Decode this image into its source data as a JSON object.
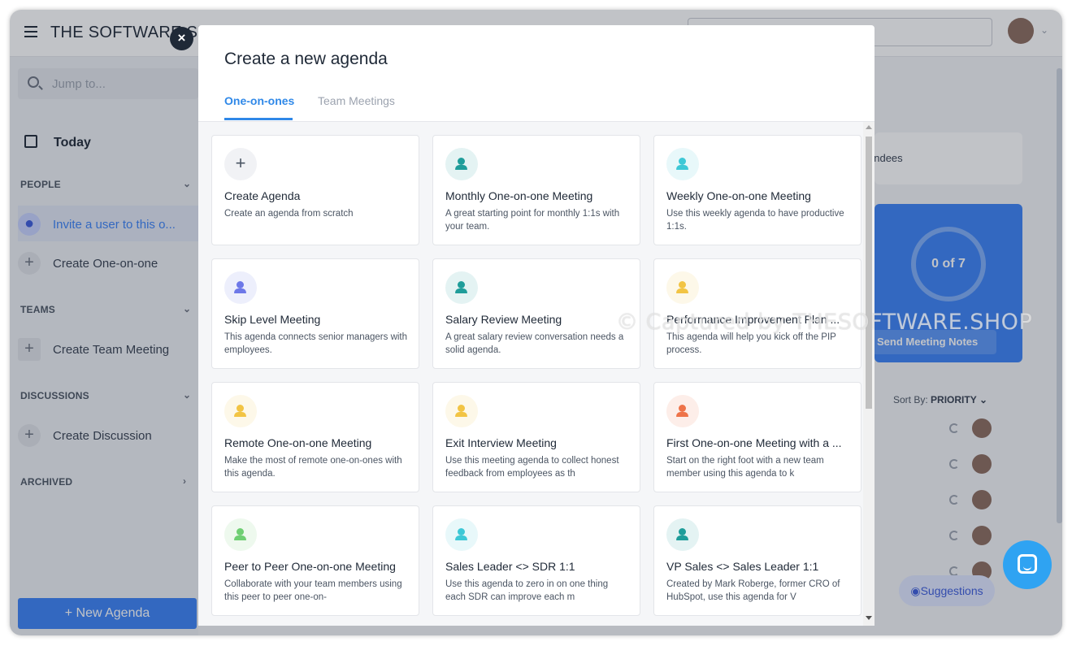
{
  "app": {
    "brand": "THE SOFTWARE SHOP",
    "search_placeholder": "Jump to...",
    "today_label": "Today",
    "sections": {
      "people": "PEOPLE",
      "teams": "TEAMS",
      "discussions": "DISCUSSIONS",
      "archived": "ARCHIVED"
    },
    "items": {
      "invite_user": "Invite a user to this o...",
      "create_one_on_one": "Create One-on-one",
      "create_team_meeting": "Create Team Meeting",
      "create_discussion": "Create Discussion"
    },
    "new_agenda_label": "New Agenda"
  },
  "background_panel": {
    "attendees_text": "endees",
    "progress_text": "0 of 7",
    "send_notes_label": "& Send Meeting Notes",
    "sort_by_label": "Sort By:",
    "sort_by_value": "PRIORITY",
    "suggestions_label": "Suggestions"
  },
  "modal": {
    "close_label": "×",
    "title": "Create a new agenda",
    "tabs": [
      {
        "label": "One-on-ones",
        "active": true
      },
      {
        "label": "Team Meetings",
        "active": false
      }
    ],
    "cards": [
      {
        "title": "Create Agenda",
        "desc": "Create an agenda from scratch",
        "icon": "plus-icon",
        "color": "#f1f2f5"
      },
      {
        "title": "Monthly One-on-one Meeting",
        "desc": "A great starting point for monthly 1:1s with your team.",
        "icon": "person-icon",
        "color": "#1f9d9a"
      },
      {
        "title": "Weekly One-on-one Meeting",
        "desc": "Use this weekly agenda to have productive 1:1s.",
        "icon": "person-icon",
        "color": "#3ec8d6"
      },
      {
        "title": "Skip Level Meeting",
        "desc": "This agenda connects senior managers with employees.",
        "icon": "person-icon",
        "color": "#6d78e8"
      },
      {
        "title": "Salary Review Meeting",
        "desc": "A great salary review conversation needs a solid agenda.",
        "icon": "person-icon",
        "color": "#1f9d9a"
      },
      {
        "title": "Performance Improvement Plan ...",
        "desc": "This agenda will help you kick off the PIP process.",
        "icon": "person-icon",
        "color": "#f2c444"
      },
      {
        "title": "Remote One-on-one Meeting",
        "desc": "Make the most of remote one-on-ones with this agenda.",
        "icon": "person-icon",
        "color": "#f2c444"
      },
      {
        "title": "Exit Interview Meeting",
        "desc": "Use this meeting agenda to collect honest feedback from employees as th",
        "icon": "person-icon",
        "color": "#f2c444"
      },
      {
        "title": "First One-on-one Meeting with a ...",
        "desc": "Start on the right foot with a new team member using this agenda to k",
        "icon": "person-icon",
        "color": "#ee7349"
      },
      {
        "title": "Peer to Peer One-on-one Meeting",
        "desc": "Collaborate with your team members using this peer to peer one-on-",
        "icon": "person-icon",
        "color": "#6fcf73"
      },
      {
        "title": "Sales Leader <> SDR 1:1",
        "desc": "Use this agenda to zero in on one thing each SDR can improve each m",
        "icon": "person-icon",
        "color": "#3ec8d6"
      },
      {
        "title": "VP Sales <> Sales Leader 1:1",
        "desc": "Created by Mark Roberge, former CRO of HubSpot, use this agenda for V",
        "icon": "person-icon",
        "color": "#1f9d9a"
      }
    ]
  },
  "watermark": "© Captured by THESOFTWARE.SHOP",
  "colors": {
    "accent": "#3b82f6",
    "tab_active": "#2f88e8"
  }
}
